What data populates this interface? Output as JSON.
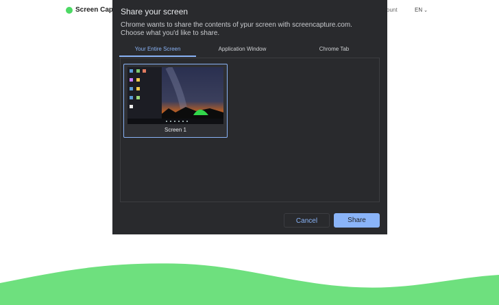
{
  "site": {
    "logo_text": "Screen Capt",
    "account_link": "ccount",
    "language": "EN",
    "brand_color": "#4cd964"
  },
  "dialog": {
    "title": "Share your screen",
    "description_line1": "Chrome wants to share the contents of ypur screen with screencapture.com.",
    "description_line2": "Choose what you'd like to share.",
    "tabs": [
      {
        "label": "Your Entire Screen",
        "active": true
      },
      {
        "label": "Application Window",
        "active": false
      },
      {
        "label": "Chrome Tab",
        "active": false
      }
    ],
    "sources": [
      {
        "label": "Screen 1",
        "selected": true
      }
    ],
    "cancel_label": "Cancel",
    "share_label": "Share",
    "accent_color": "#8ab4f8"
  }
}
